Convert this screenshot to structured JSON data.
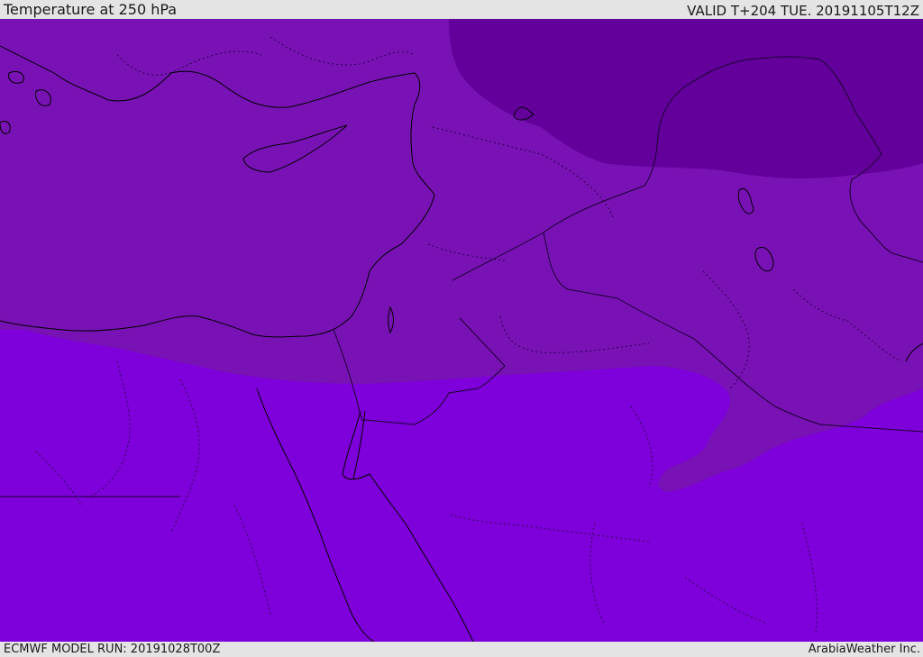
{
  "header": {
    "title": "Temperature at 250 hPa",
    "valid_time": "VALID T+204 TUE. 20191105T12Z"
  },
  "footer": {
    "model_run": "ECMWF MODEL RUN: 20191028T00Z",
    "credit": "ArabiaWeather Inc."
  },
  "map": {
    "colors": {
      "band_cold": "#63009c",
      "band_mid": "#7812b4",
      "band_warm": "#7e00da",
      "coastline": "#000000",
      "border": "#1a0030"
    }
  }
}
